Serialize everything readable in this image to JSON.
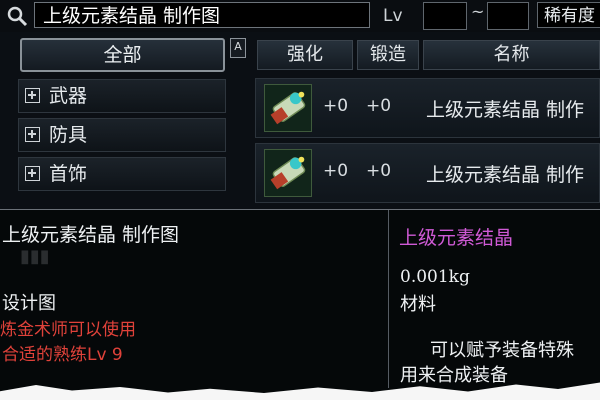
{
  "search": {
    "value": "上级元素结晶 制作图"
  },
  "filters": {
    "lv_label": "Lv",
    "lv_separator": "~",
    "rarity_label": "稀有度"
  },
  "sidebar": {
    "all_label": "全部",
    "scroll_up_glyph": "A",
    "items": [
      {
        "label": "武器"
      },
      {
        "label": "防具"
      },
      {
        "label": "首饰"
      }
    ]
  },
  "table": {
    "headers": [
      "强化",
      "锻造",
      "名称"
    ],
    "rows": [
      {
        "enhance": "+0",
        "forge": "+0",
        "name": "上级元素结晶 制作"
      },
      {
        "enhance": "+0",
        "forge": "+0",
        "name": "上级元素结晶 制作"
      }
    ]
  },
  "tooltip": {
    "title": "上级元素结晶 制作图",
    "type": "设计图",
    "req_job": "炼金术师可以使用",
    "req_level": "合适的熟练Lv 9",
    "name_right": "上级元素结晶",
    "weight": "0.001kg",
    "category": "材料",
    "desc_line1": "可以赋予装备特殊",
    "desc_line2": "用来合成装备"
  },
  "colors": {
    "accent_red": "#e0423a",
    "item_name_purple": "#d05ad6",
    "panel_bg": "#0b0f14"
  }
}
